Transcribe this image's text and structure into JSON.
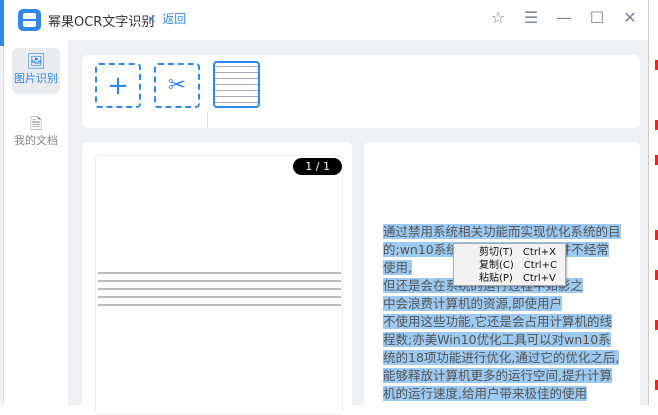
{
  "app": {
    "title": "幂果OCR文字识别",
    "back_label": "返回"
  },
  "window_controls": [
    "star-icon",
    "menu-icon",
    "minimize-icon",
    "maximize-icon",
    "close-icon"
  ],
  "sidebar": {
    "items": [
      {
        "label": "图片识别",
        "icon": "image-icon",
        "active": true
      },
      {
        "label": "我的文档",
        "icon": "document-icon",
        "active": false
      }
    ]
  },
  "toolbar": {
    "add_icon": "plus-icon",
    "crop_icon": "scissors-icon"
  },
  "preview": {
    "page_indicator": "1 / 1"
  },
  "result": {
    "lines": [
      "通过禁用系统相关功能而实现优化系统的目",
      "的;wn10系统中有很多功能用户并不经常使用,",
      "但还是会在系统的运行过程中如影之",
      "中会浪费计算机的资源,即使用户",
      "不使用这些功能,它还是会占用计算机的线",
      "程数;亦美Win10优化工具可以对wn10系",
      "统的18项功能进行优化,通过它的优化之后,",
      "能够释放计算机更多的运行空间,提升计算",
      "机的运行速度,给用户带来极佳的使用"
    ]
  },
  "context_menu": {
    "items": [
      {
        "label": "剪切(T)",
        "shortcut": "Ctrl+X"
      },
      {
        "label": "复制(C)",
        "shortcut": "Ctrl+C"
      },
      {
        "label": "粘贴(P)",
        "shortcut": "Ctrl+V"
      }
    ]
  },
  "colors": {
    "accent": "#2f88ea",
    "selection": "#9ccaf2",
    "background": "#eef0f4"
  }
}
